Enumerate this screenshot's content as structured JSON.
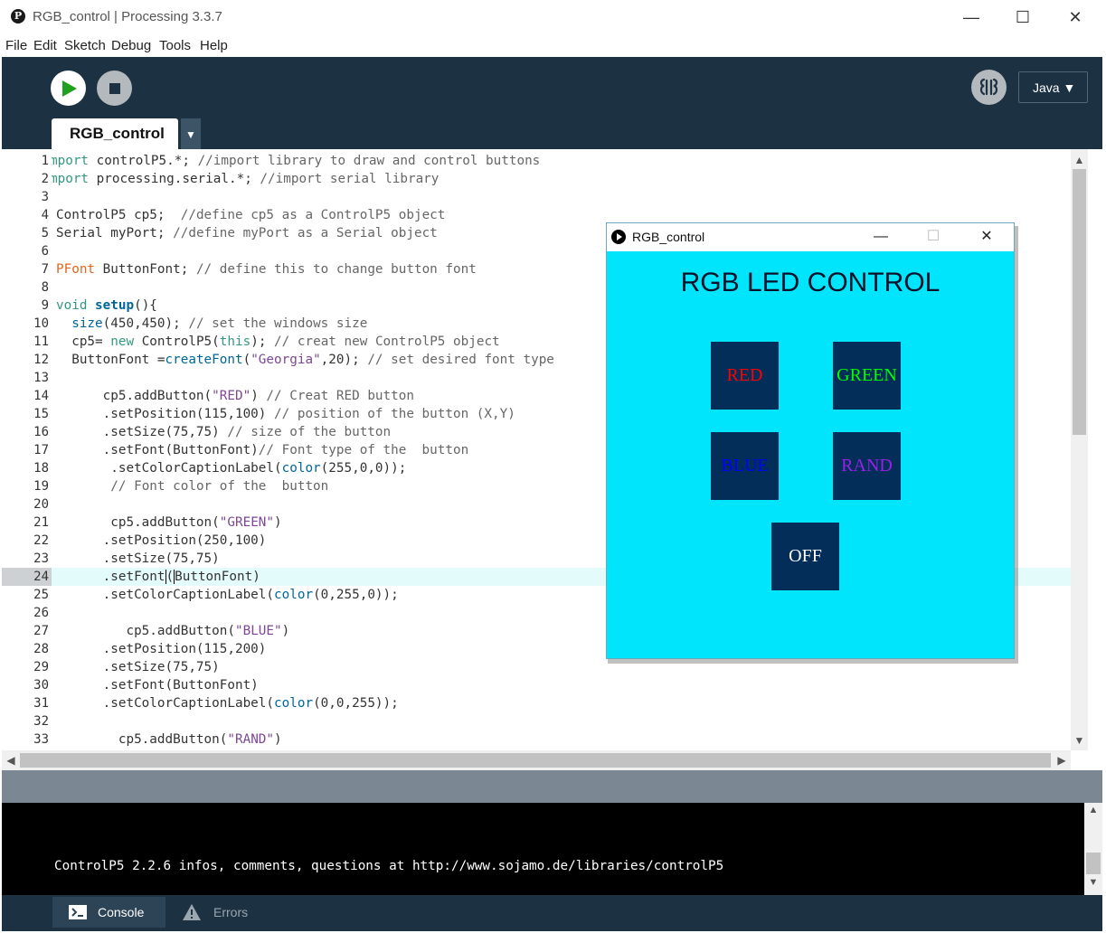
{
  "window": {
    "title": "RGB_control | Processing 3.3.7",
    "minimize": "—",
    "maximize": "☐",
    "close": "✕"
  },
  "menu": [
    "File",
    "Edit",
    "Sketch",
    "Debug",
    "Tools",
    "Help"
  ],
  "toolbar": {
    "mode": "Java ▼",
    "tab_name": "RGB_control",
    "tab_menu": "▼"
  },
  "editor": {
    "current_line": 24,
    "lines": [
      "mport controlP5.*; //import library to draw and control buttons",
      "mport processing.serial.*; //import serial library",
      "",
      "ControlP5 cp5;  //define cp5 as a ControlP5 object",
      "Serial myPort; //define myPort as a Serial object",
      "",
      "PFont ButtonFont; // define this to change button font",
      "",
      "void setup(){",
      "  size(450,450); // set the windows size",
      "  cp5= new ControlP5(this); // creat new ControlP5 object",
      "  ButtonFont =createFont(\"Georgia\",20); // set desired font type",
      "",
      "      cp5.addButton(\"RED\") // Creat RED button",
      "      .setPosition(115,100) // position of the button (X,Y)",
      "      .setSize(75,75) // size of the button",
      "      .setFont(ButtonFont)// Font type of the  button",
      "       .setColorCaptionLabel(color(255,0,0));",
      "       // Font color of the  button",
      "",
      "       cp5.addButton(\"GREEN\")",
      "      .setPosition(250,100)",
      "      .setSize(75,75)",
      "      .setFont(ButtonFont)",
      "      .setColorCaptionLabel(color(0,255,0));",
      "",
      "         cp5.addButton(\"BLUE\")",
      "      .setPosition(115,200)",
      "      .setSize(75,75)",
      "      .setFont(ButtonFont)",
      "      .setColorCaptionLabel(color(0,0,255));",
      "",
      "        cp5.addButton(\"RAND\")"
    ]
  },
  "console": {
    "text": "ControlP5 2.2.6 infos, comments, questions at http://www.sojamo.de/libraries/controlP5",
    "tabs": [
      "Console",
      "Errors"
    ]
  },
  "sketch": {
    "title": "RGB_control",
    "heading": "RGB LED CONTROL",
    "background": "#00e5fb",
    "button_color": "#022e59",
    "buttons": [
      {
        "label": "RED",
        "color": "#ff0000"
      },
      {
        "label": "GREEN",
        "color": "#00ff00"
      },
      {
        "label": "BLUE",
        "color": "#0000ff"
      },
      {
        "label": "RAND",
        "color": "#9b1fe8"
      },
      {
        "label": "OFF",
        "color": "#ffffff"
      }
    ]
  }
}
